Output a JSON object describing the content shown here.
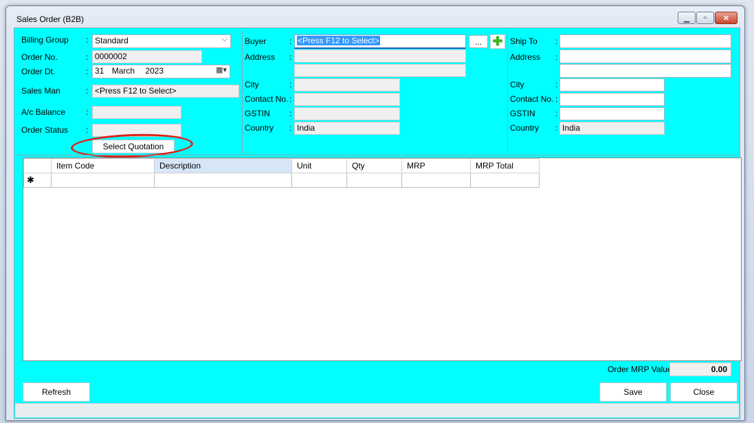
{
  "window": {
    "title": "Sales Order (B2B)"
  },
  "form": {
    "billing_group": {
      "label": "Billing Group",
      "value": "Standard"
    },
    "order_no": {
      "label": "Order No.",
      "value": "0000002"
    },
    "order_dt": {
      "label": "Order Dt.",
      "day": "31",
      "month": "March",
      "year": "2023"
    },
    "sales_man": {
      "label": "Sales Man",
      "value": "<Press F12 to Select>"
    },
    "ac_balance": {
      "label": "A/c Balance",
      "value": ""
    },
    "order_status": {
      "label": "Order Status",
      "value": ""
    },
    "select_quotation": "Select Quotation",
    "colon": ":"
  },
  "buyer": {
    "label": "Buyer",
    "value": "<Press F12 to Select>",
    "browse": "...",
    "address_label": "Address",
    "address1": "",
    "address2": "",
    "city_label": "City",
    "city": "",
    "contact_label": "Contact No.",
    "contact": "",
    "gstin_label": "GSTIN",
    "gstin": "",
    "country_label": "Country",
    "country": "India"
  },
  "ship_to": {
    "label": "Ship To",
    "value": "",
    "address_label": "Address",
    "address1": "",
    "address2": "",
    "city_label": "City",
    "city": "",
    "contact_label": "Contact No.",
    "contact": "",
    "gstin_label": "GSTIN",
    "gstin": "",
    "country_label": "Country",
    "country": "India"
  },
  "grid": {
    "columns": [
      "Item Code",
      "Description",
      "Unit",
      "Qty",
      "MRP",
      "MRP Total"
    ],
    "new_row_marker": "✱"
  },
  "totals": {
    "label": "Order MRP Value :",
    "value": "0.00"
  },
  "buttons": {
    "refresh": "Refresh",
    "save": "Save",
    "close": "Close"
  },
  "colors": {
    "client_bg": "#00ffff",
    "selection": "#3399ff",
    "annotation": "#e0201a"
  }
}
